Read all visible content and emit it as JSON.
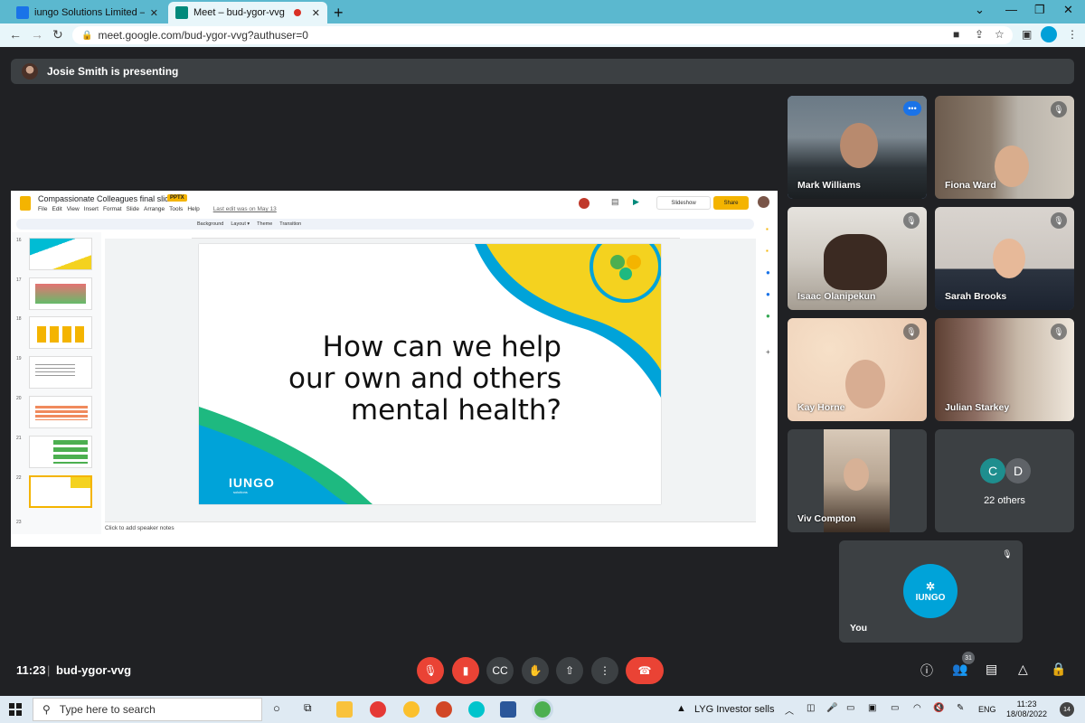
{
  "browser": {
    "tabs": [
      {
        "title": "iungo Solutions Limited – Calend",
        "fav_color": "#1a73e8"
      },
      {
        "title": "Meet – bud-ygor-vvg",
        "fav_color": "#00897b"
      }
    ],
    "new_tab": "+",
    "url": "meet.google.com/bud-ygor-vvg?authuser=0"
  },
  "meeting": {
    "presenting_banner": "Josie Smith is presenting",
    "time": "11:23",
    "separator": "|",
    "code": "bud-ygor-vvg",
    "participant_count_badge": "31"
  },
  "slides_app": {
    "doc_title": "Compassionate Colleagues final slides",
    "badge": "PPTX",
    "menu": [
      "File",
      "Edit",
      "View",
      "Insert",
      "Format",
      "Slide",
      "Arrange",
      "Tools",
      "Help"
    ],
    "last_edit": "Last edit was on May 13",
    "slideshow": "Slideshow",
    "share": "Share",
    "toolbar_items": [
      "Background",
      "Layout ▾",
      "Theme",
      "Transition"
    ],
    "slide_numbers": [
      "16",
      "17",
      "18",
      "19",
      "20",
      "21",
      "22",
      "23"
    ],
    "slide_text": "How can we help our own and others mental health?",
    "logo_text": "IUNGO",
    "logo_sub": "solutions",
    "speaker_notes": "Click to add speaker notes"
  },
  "participants": [
    {
      "name": "Mark Williams",
      "muted": false
    },
    {
      "name": "Fiona Ward",
      "muted": true
    },
    {
      "name": "Isaac Olanipekun",
      "muted": true
    },
    {
      "name": "Sarah Brooks",
      "muted": true
    },
    {
      "name": "Kay Horne",
      "muted": true
    },
    {
      "name": "Julian Starkey",
      "muted": true
    },
    {
      "name": "Viv Compton",
      "muted": false
    }
  ],
  "others": {
    "initials": [
      "C",
      "D"
    ],
    "label": "22 others"
  },
  "self_tile": {
    "label": "You",
    "avatar_text": "IUNGO"
  },
  "taskbar": {
    "search_placeholder": "Type here to search",
    "stock_ticker": "LYG  Investor sells",
    "language": "ENG",
    "clock_time": "11:23",
    "clock_date": "18/08/2022",
    "notifications": "14"
  },
  "colors": {
    "tabbar": "#5bb8cf",
    "meet_bg": "#202124",
    "accent_yellow": "#f4b400",
    "accent_blue": "#00a3d9",
    "end_call": "#ea4335"
  }
}
